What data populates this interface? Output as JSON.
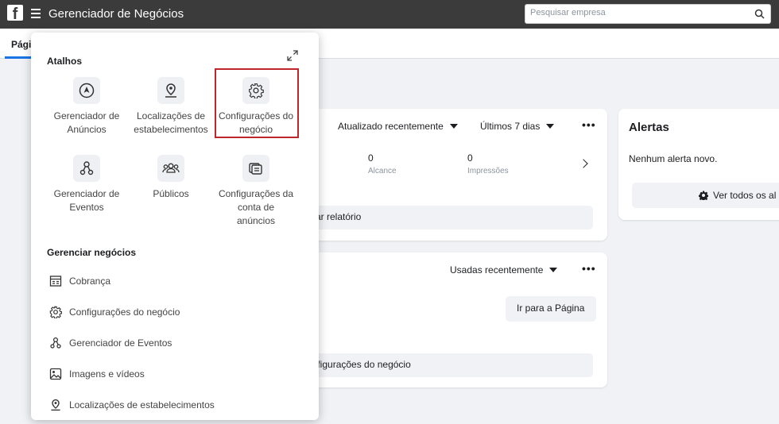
{
  "header": {
    "logo": "f",
    "title": "Gerenciador de Negócios",
    "search_placeholder": "Pesquisar empresa"
  },
  "background": {
    "tab_label": "Pági",
    "card1": {
      "dropdown_update": "Atualizado recentemente",
      "dropdown_period": "Últimos 7 dias",
      "more": "•••",
      "metrics": [
        {
          "value": "0",
          "label": "Alcance"
        },
        {
          "value": "0",
          "label": "Impressões"
        }
      ],
      "report_button": "ar relatório"
    },
    "card2": {
      "dropdown_used": "Usadas recentemente",
      "more": "•••",
      "go_to_page_button": "Ir para a Página",
      "settings_button": "onfigurações do negócio"
    },
    "alerts": {
      "title": "Alertas",
      "empty_text": "Nenhum alerta novo.",
      "view_all_button": "Ver todos os al"
    }
  },
  "menu": {
    "shortcuts_title": "Atalhos",
    "shortcuts": [
      {
        "icon": "navigation-icon",
        "label_line1": "Gerenciador de",
        "label_line2": "Anúncios"
      },
      {
        "icon": "location-pin-icon",
        "label_line1": "Localizações de",
        "label_line2": "estabelecimentos"
      },
      {
        "icon": "gear-icon",
        "label_line1": "Configurações do",
        "label_line2": "negócio"
      },
      {
        "icon": "event-tree-icon",
        "label_line1": "Gerenciador de",
        "label_line2": "Eventos"
      },
      {
        "icon": "audience-icon",
        "label_line1": "Públicos",
        "label_line2": ""
      },
      {
        "icon": "ad-account-settings-icon",
        "label_line1": "Configurações da",
        "label_line2": "conta de",
        "label_line3": "anúncios"
      }
    ],
    "manage_title": "Gerenciar negócios",
    "manage_items": [
      {
        "icon": "billing-icon",
        "label": "Cobrança"
      },
      {
        "icon": "gear-icon",
        "label": "Configurações do negócio"
      },
      {
        "icon": "event-tree-icon",
        "label": "Gerenciador de Eventos"
      },
      {
        "icon": "image-icon",
        "label": "Imagens e vídeos"
      },
      {
        "icon": "location-pin-icon",
        "label": "Localizações de estabelecimentos"
      }
    ]
  },
  "colors": {
    "topbar": "#3b3b3b",
    "highlight": "#c0272d",
    "accent": "#1b74e4"
  }
}
